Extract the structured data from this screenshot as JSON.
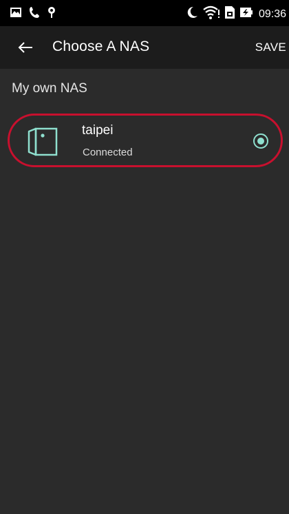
{
  "status_bar": {
    "time": "09:36",
    "icons": [
      "notification-image-icon",
      "phone-icon",
      "location-pin-icon",
      "do-not-disturb-moon-icon",
      "wifi-icon",
      "sim-icon",
      "battery-charging-icon"
    ]
  },
  "toolbar": {
    "title": "Choose A NAS",
    "save_label": "SAVE",
    "back_icon": "arrow-back-icon"
  },
  "section": {
    "header": "My own NAS"
  },
  "nas_list": [
    {
      "name": "taipei",
      "status": "Connected",
      "selected": true,
      "icon": "nas-device-icon"
    }
  ],
  "colors": {
    "accent": "#8fe0cf",
    "highlight_ring": "#c8102e",
    "background": "#2b2b2b",
    "toolbar": "#1c1c1c"
  }
}
